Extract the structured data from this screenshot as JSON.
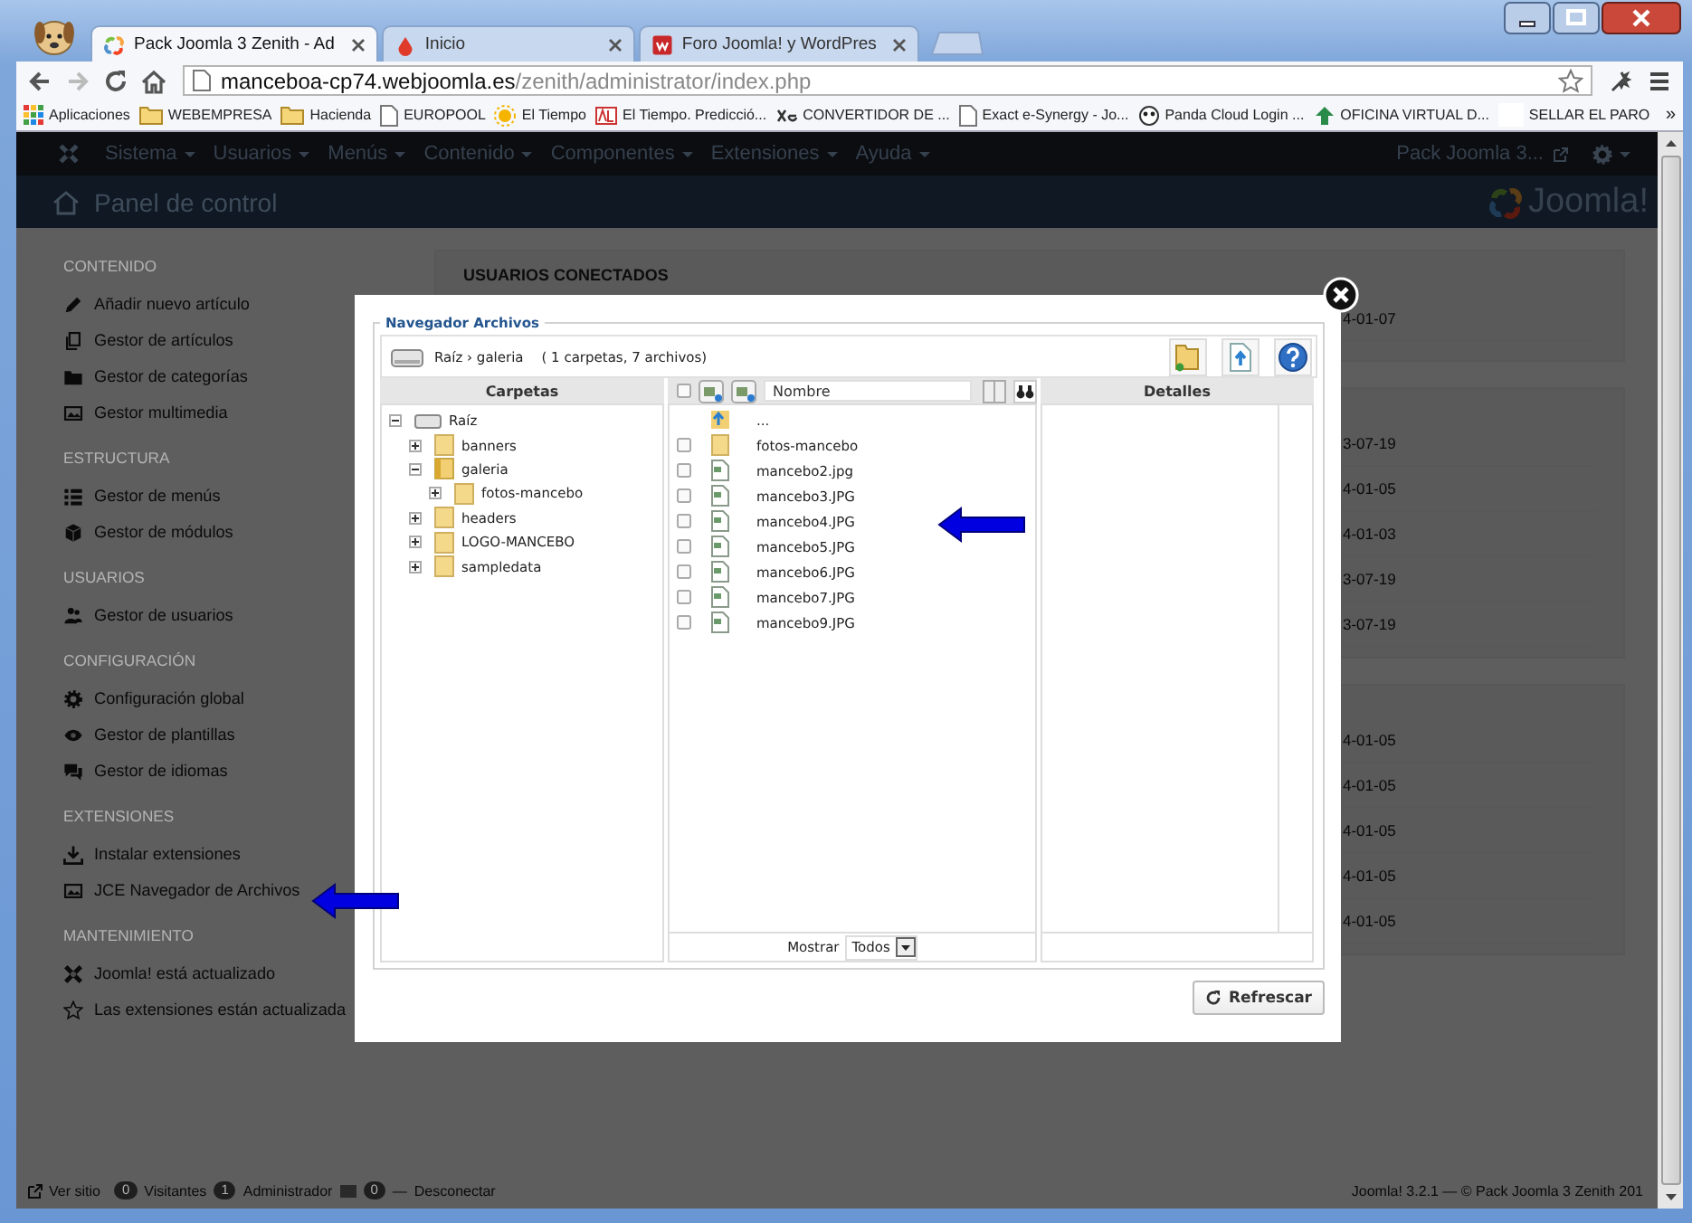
{
  "browser": {
    "tabs": [
      {
        "title": "Pack Joomla 3 Zenith - Ad",
        "selected": true
      },
      {
        "title": "Inicio",
        "selected": false
      },
      {
        "title": "Foro Joomla! y WordPres",
        "selected": false
      }
    ],
    "address": {
      "host": "manceboa-cp74.webjoomla.es",
      "path": "/zenith/administrator/index.php"
    },
    "bookmarks": [
      {
        "kind": "apps",
        "label": "Aplicaciones"
      },
      {
        "kind": "folder",
        "label": "WEBEMPRESA"
      },
      {
        "kind": "folder",
        "label": "Hacienda"
      },
      {
        "kind": "page",
        "label": "EUROPOOL"
      },
      {
        "kind": "site",
        "label": "El Tiempo"
      },
      {
        "kind": "site",
        "label": "El Tiempo. Predicció..."
      },
      {
        "kind": "site",
        "label": "CONVERTIDOR DE ..."
      },
      {
        "kind": "page",
        "label": "Exact e-Synergy - Jo..."
      },
      {
        "kind": "site",
        "label": "Panda Cloud Login ..."
      },
      {
        "kind": "site",
        "label": "OFICINA VIRTUAL D..."
      },
      {
        "kind": "blank",
        "label": "SELLAR EL PARO"
      }
    ],
    "bookmarks_overflow": "»"
  },
  "admin_bar": {
    "menus": [
      "Sistema",
      "Usuarios",
      "Menús",
      "Contenido",
      "Componentes",
      "Extensiones",
      "Ayuda"
    ],
    "site_name": "Pack Joomla 3..."
  },
  "header": {
    "title": "Panel de control",
    "logo_text": "Joomla!"
  },
  "sidebar": {
    "sections": [
      {
        "heading": "CONTENIDO",
        "items": [
          {
            "label": "Añadir nuevo artículo"
          },
          {
            "label": "Gestor de artículos"
          },
          {
            "label": "Gestor de categorías"
          },
          {
            "label": "Gestor multimedia"
          }
        ]
      },
      {
        "heading": "ESTRUCTURA",
        "items": [
          {
            "label": "Gestor de menús"
          },
          {
            "label": "Gestor de módulos"
          }
        ]
      },
      {
        "heading": "USUARIOS",
        "items": [
          {
            "label": "Gestor de usuarios"
          }
        ]
      },
      {
        "heading": "CONFIGURACIÓN",
        "items": [
          {
            "label": "Configuración global"
          },
          {
            "label": "Gestor de plantillas"
          },
          {
            "label": "Gestor de idiomas"
          }
        ]
      },
      {
        "heading": "EXTENSIONES",
        "items": [
          {
            "label": "Instalar extensiones"
          },
          {
            "label": "JCE Navegador de Archivos"
          }
        ]
      },
      {
        "heading": "MANTENIMIENTO",
        "items": [
          {
            "label": "Joomla! está actualizado"
          },
          {
            "label": "Las extensiones están actualizada"
          }
        ]
      }
    ]
  },
  "cards": [
    {
      "heading": "USUARIOS CONECTADOS",
      "rows": [
        "4-01-07"
      ]
    },
    {
      "rows": [
        "3-07-19",
        "4-01-05",
        "4-01-03",
        "3-07-19",
        "3-07-19"
      ]
    },
    {
      "rows": [
        "4-01-05",
        "4-01-05",
        "4-01-05",
        "4-01-05",
        "4-01-05"
      ]
    }
  ],
  "file_browser": {
    "legend": "Navegador Archivos",
    "path": "Raíz › galeria",
    "summary": "( 1 carpetas, 7 archivos)",
    "folders_header": "Carpetas",
    "name_header": "Nombre",
    "details_header": "Detalles",
    "select_all": {
      "checked": false
    },
    "tree": [
      {
        "kind": "drive",
        "label": "Raíz",
        "expanded": true,
        "children": [
          {
            "kind": "folder",
            "label": "banners",
            "expanded": false
          },
          {
            "kind": "folder",
            "label": "galeria",
            "expanded": true,
            "children": [
              {
                "kind": "folder",
                "label": "fotos-mancebo",
                "expanded": false
              }
            ]
          },
          {
            "kind": "folder",
            "label": "headers",
            "expanded": false
          },
          {
            "kind": "folder",
            "label": "LOGO-MANCEBO",
            "expanded": false
          },
          {
            "kind": "folder",
            "label": "sampledata",
            "expanded": false
          }
        ]
      }
    ],
    "files": [
      {
        "kind": "parent",
        "name": "..."
      },
      {
        "kind": "folder",
        "name": "fotos-mancebo",
        "checked": false
      },
      {
        "kind": "file",
        "name": "mancebo2.jpg",
        "checked": false
      },
      {
        "kind": "file",
        "name": "mancebo3.JPG",
        "checked": false
      },
      {
        "kind": "file",
        "name": "mancebo4.JPG",
        "checked": false
      },
      {
        "kind": "file",
        "name": "mancebo5.JPG",
        "checked": false
      },
      {
        "kind": "file",
        "name": "mancebo6.JPG",
        "checked": false
      },
      {
        "kind": "file",
        "name": "mancebo7.JPG",
        "checked": false
      },
      {
        "kind": "file",
        "name": "mancebo9.JPG",
        "checked": false
      }
    ],
    "show_label": "Mostrar",
    "show_value": "Todos",
    "refresh_button": "Refrescar"
  },
  "status_bar": {
    "view_site": "Ver sitio",
    "visitors_count": "0",
    "visitors_label": "Visitantes",
    "admins_count": "1",
    "admins_label": "Administrador",
    "messages_count": "0",
    "separator": "—",
    "logout": "Desconectar",
    "version": "Joomla! 3.2.1 — © Pack Joomla 3 Zenith 201"
  }
}
